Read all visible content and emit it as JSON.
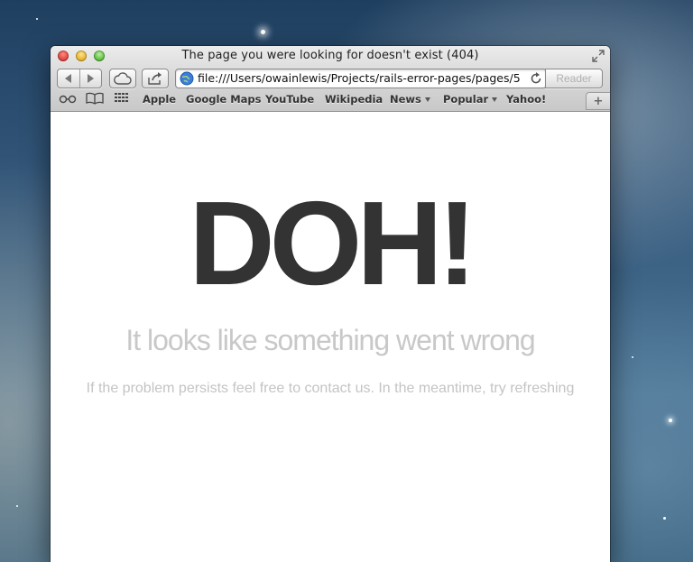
{
  "window": {
    "title": "The page you were looking for doesn't exist (404)"
  },
  "toolbar": {
    "url": "file:///Users/owainlewis/Projects/rails-error-pages/pages/5",
    "reader_label": "Reader",
    "icons": [
      "back-arrow-icon",
      "forward-arrow-icon",
      "icloud-icon",
      "share-icon",
      "globe-icon",
      "reload-icon",
      "fullscreen-icon"
    ]
  },
  "bookmarks": {
    "items": [
      {
        "label": "Apple"
      },
      {
        "label": "Google Maps"
      },
      {
        "label": "YouTube"
      },
      {
        "label": "Wikipedia"
      },
      {
        "label": "News"
      },
      {
        "label": "Popular"
      },
      {
        "label": "Yahoo!"
      }
    ],
    "icons": [
      "reading-list-icon",
      "bookmarks-book-icon",
      "top-sites-grid-icon"
    ],
    "new_tab_label": "+"
  },
  "page": {
    "headline": "DOH!",
    "subheadline": "It looks like something went wrong",
    "body": "If the problem persists feel free to contact us. In the meantime, try refreshing"
  }
}
